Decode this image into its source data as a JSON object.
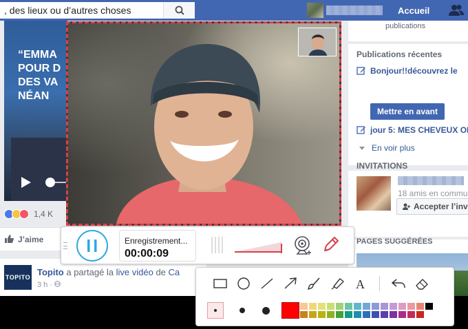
{
  "facebook": {
    "search_placeholder": ", des lieux ou d’autres choses",
    "nav_home": "Accueil",
    "video_text": "“EMMA\nPOUR D\nDES VA\nNÉAN",
    "reaction_count": "1,4 K",
    "like_label": "J’aime",
    "post": {
      "page_name": "Topito",
      "logo_text": "TOPITO",
      "action_1": " a partagé la ",
      "link_text": "live vidéo",
      "action_2": " de ",
      "target": "Ca",
      "time": "3 h · "
    },
    "right": {
      "publications_label": "publications",
      "recent_heading": "Publications récentes",
      "recent_items": [
        "Bonjour!!découvrez le",
        "jour 5: MES CHEVEUX OI"
      ],
      "promote_button": "Mettre en avant",
      "see_more": "En voir plus",
      "invitations_heading": "INVITATIONS",
      "invitation_friends": "18 amis en commu",
      "accept_button": "Accepter l’inv",
      "pages_heading": "PAGES SUGGÉRÉES"
    }
  },
  "recorder": {
    "status_label": "Enregistrement...",
    "elapsed": "00:00:09",
    "volume_level": 1.0,
    "accent_color": "#2fa8e0",
    "border_color": "#d4424c"
  },
  "draw_tools": {
    "tools": [
      "rectangle-icon",
      "ellipse-icon",
      "line-icon",
      "arrow-icon",
      "brush-icon",
      "highlighter-icon",
      "text-icon",
      "undo-icon",
      "eraser-icon"
    ],
    "sizes": [
      "small",
      "medium",
      "large"
    ],
    "selected_color": "#ff0000",
    "palette": [
      "#f5c89a",
      "#f2d77a",
      "#e4e07c",
      "#c9dd72",
      "#9fd07a",
      "#6fc4a3",
      "#5fb8c8",
      "#74a6d6",
      "#8c9ad6",
      "#a996d4",
      "#c49ad3",
      "#dc9cc2",
      "#e89aa0",
      "#e88474",
      "#000000",
      "#c8821e",
      "#c8a416",
      "#b9b30e",
      "#8fb21c",
      "#45a13a",
      "#139a86",
      "#1b8fb0",
      "#2f6fb8",
      "#3e4fb0",
      "#5a3fae",
      "#7a35a4",
      "#a62f8a",
      "#c22b5a",
      "#c8281e",
      "#ffffff"
    ]
  }
}
